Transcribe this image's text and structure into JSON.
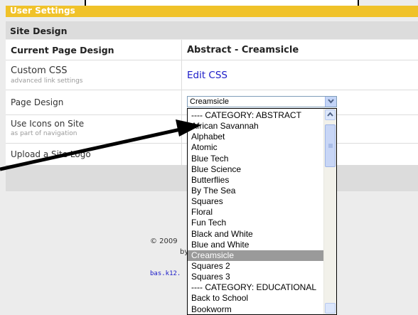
{
  "header": {
    "title": "User Settings"
  },
  "section": {
    "title": "Site Design"
  },
  "rows": {
    "current_design_label": "Current Page Design",
    "current_design_value": "Abstract - Creamsicle",
    "custom_css_label": "Custom CSS",
    "custom_css_sub": "advanced link settings",
    "custom_css_link": "Edit CSS",
    "page_design_label": "Page Design",
    "icons_label": "Use Icons on Site",
    "icons_sub": "as part of navigation",
    "upload_label": "Upload a Site Logo"
  },
  "select": {
    "value": "Creamsicle",
    "options": [
      "---- CATEGORY: ABSTRACT",
      "African Savannah",
      "Alphabet",
      "Atomic",
      "Blue Tech",
      "Blue Science",
      "Butterflies",
      "By The Sea",
      "Squares",
      "Floral",
      "Fun Tech",
      "Black and White",
      "Blue and White",
      "Creamsicle",
      "Squares 2",
      "Squares 3",
      "---- CATEGORY: EDUCATIONAL",
      "Back to School",
      "Bookworm"
    ],
    "highlighted": "Creamsicle"
  },
  "footer": {
    "line1": "© 2009 ",
    "line2": "by",
    "line3": "bas.k12."
  },
  "colors": {
    "header": "#f0c229",
    "section": "#dcdcdc",
    "link": "#1a1ac8",
    "highlight": "#9a9a9a"
  },
  "icons": [
    "chevron-down-icon",
    "scroll-up-icon",
    "scroll-down-icon",
    "arrow-annotation"
  ]
}
